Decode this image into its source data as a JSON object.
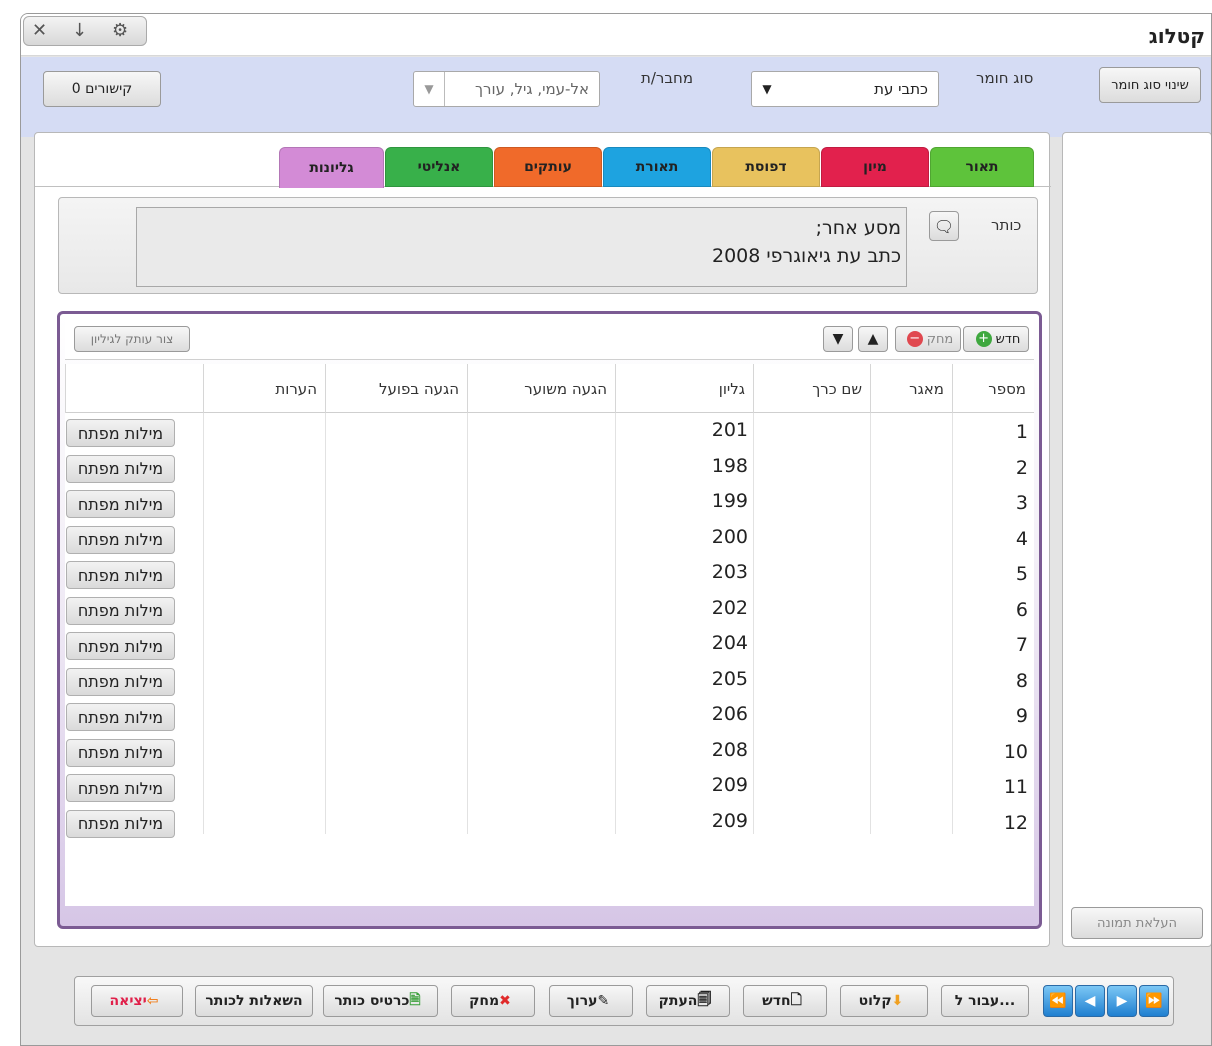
{
  "window": {
    "title": "קטלוג",
    "controls": [
      "close-icon",
      "minimize-icon",
      "settings-icon"
    ]
  },
  "top": {
    "change_type_button": "שינוי סוג חומר",
    "material_type_label": "סוג חומר",
    "material_type_value": "כתבי עת",
    "author_label": "מחבר/ת",
    "author_placeholder": "אל-עמי, גיל, עורך",
    "links_button": "0 קישורים"
  },
  "tabs": [
    {
      "label": "תאור",
      "color": "#5ec33b",
      "active": false
    },
    {
      "label": "מיון",
      "color": "#e2214d",
      "active": false
    },
    {
      "label": "דפוסת",
      "color": "#e8c25e",
      "active": false
    },
    {
      "label": "תאורת",
      "color": "#1ea3e0",
      "active": false
    },
    {
      "label": "עותקים",
      "color": "#f06a2a",
      "active": false
    },
    {
      "label": "אנליטי",
      "color": "#38b04a",
      "active": false
    },
    {
      "label": "גליונות",
      "color": "#d38bd6",
      "active": true
    }
  ],
  "title_field": {
    "label": "כותר",
    "line1": "מסע אחר;",
    "line2": "כתב עת גיאוגרפי   2008"
  },
  "toolbar": {
    "new": "חדש",
    "delete": "מחק",
    "create_copy": "צור עותק לגיליון"
  },
  "table": {
    "headers": [
      "מספר",
      "מאגר",
      "שם כרך",
      "גליון",
      "הגעה משוער",
      "הגעה בפועל",
      "הערות"
    ],
    "keyword_button": "מילות מפתח",
    "rows": [
      {
        "num": "1",
        "issue": "201"
      },
      {
        "num": "2",
        "issue": "198"
      },
      {
        "num": "3",
        "issue": "199"
      },
      {
        "num": "4",
        "issue": "200"
      },
      {
        "num": "5",
        "issue": "203"
      },
      {
        "num": "6",
        "issue": "202"
      },
      {
        "num": "7",
        "issue": "204"
      },
      {
        "num": "8",
        "issue": "205"
      },
      {
        "num": "9",
        "issue": "206"
      },
      {
        "num": "10",
        "issue": "208"
      },
      {
        "num": "11",
        "issue": "209"
      },
      {
        "num": "12",
        "issue": "209"
      }
    ]
  },
  "side": {
    "upload_image": "העלאת תמונה"
  },
  "bottom": {
    "goto": "עבור ל...",
    "import": "קלוט",
    "new": "חדש",
    "copy": "העתק",
    "edit": "ערוך",
    "delete": "מחק",
    "title_card": "כרטיס כותר",
    "loans": "השאלות לכותר",
    "exit": "יציאה"
  }
}
